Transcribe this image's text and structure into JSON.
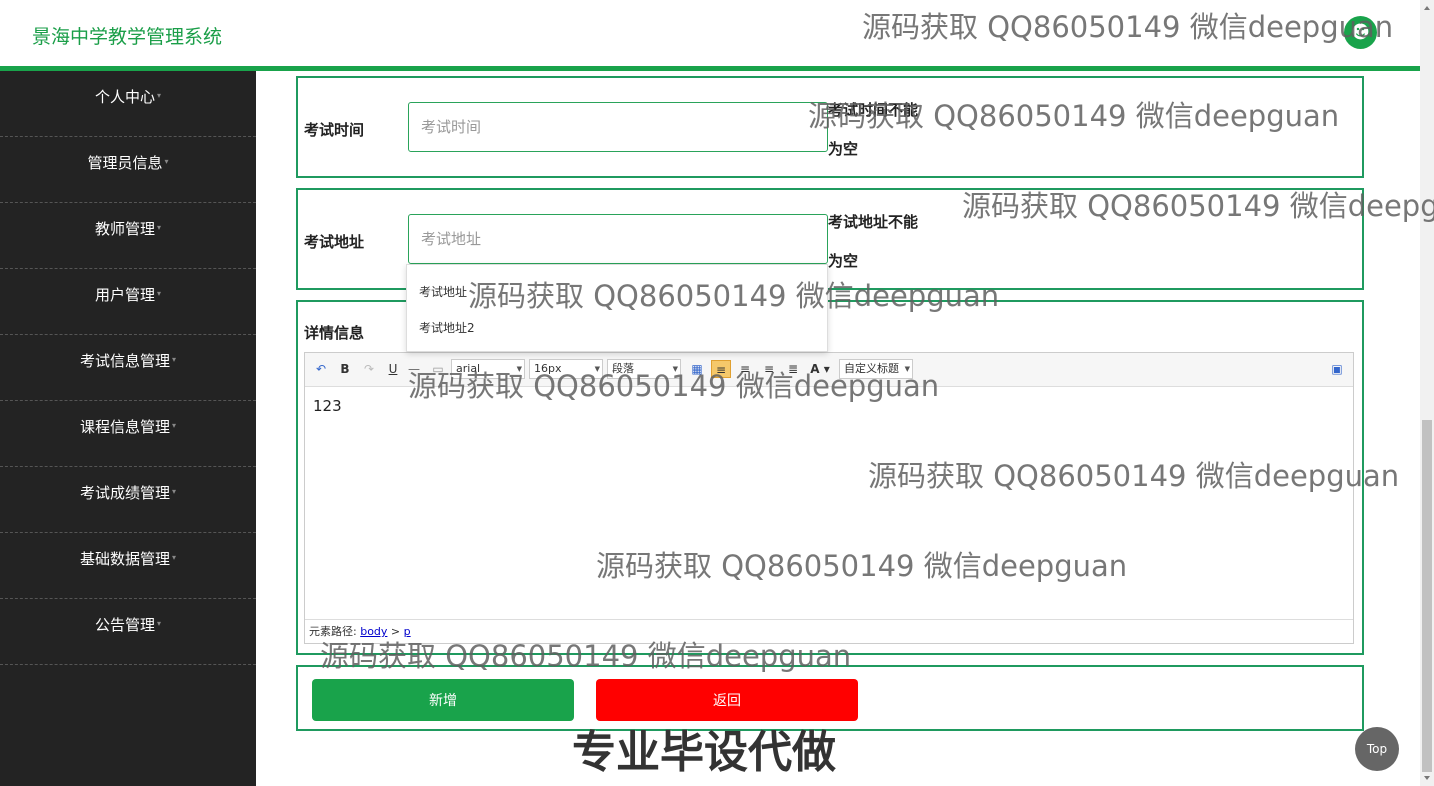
{
  "header": {
    "brand": "景海中学教学管理系统",
    "avatar_icon": "user-icon"
  },
  "sidebar": {
    "items": [
      {
        "label": "个人中心"
      },
      {
        "label": "管理员信息"
      },
      {
        "label": "教师管理"
      },
      {
        "label": "用户管理"
      },
      {
        "label": "考试信息管理"
      },
      {
        "label": "课程信息管理"
      },
      {
        "label": "考试成绩管理"
      },
      {
        "label": "基础数据管理"
      },
      {
        "label": "公告管理"
      }
    ]
  },
  "form": {
    "exam_time": {
      "label": "考试时间",
      "placeholder": "考试时间",
      "error_line1": "考试时间不能",
      "error_line2": "为空"
    },
    "exam_address": {
      "label": "考试地址",
      "placeholder": "考试地址",
      "error_line1": "考试地址不能",
      "error_line2": "为空",
      "suggestions": [
        "考试地址",
        "考试地址2"
      ]
    },
    "details": {
      "label": "详情信息",
      "editor": {
        "font": "arial",
        "size": "16px",
        "paragraph": "段落",
        "custom_title": "自定义标题",
        "content": "123",
        "path_label": "元素路径:",
        "path_body": "body",
        "path_sep": " > ",
        "path_p": "p"
      }
    }
  },
  "actions": {
    "add_label": "新增",
    "back_label": "返回"
  },
  "watermark": {
    "text": "源码获取 QQ86050149 微信deepguan",
    "banner": "专业毕设代做"
  },
  "to_top": "Top",
  "colors": {
    "brand": "#19a34b",
    "sidebar": "#232323",
    "add": "#19a34b",
    "back": "#ff0000"
  }
}
